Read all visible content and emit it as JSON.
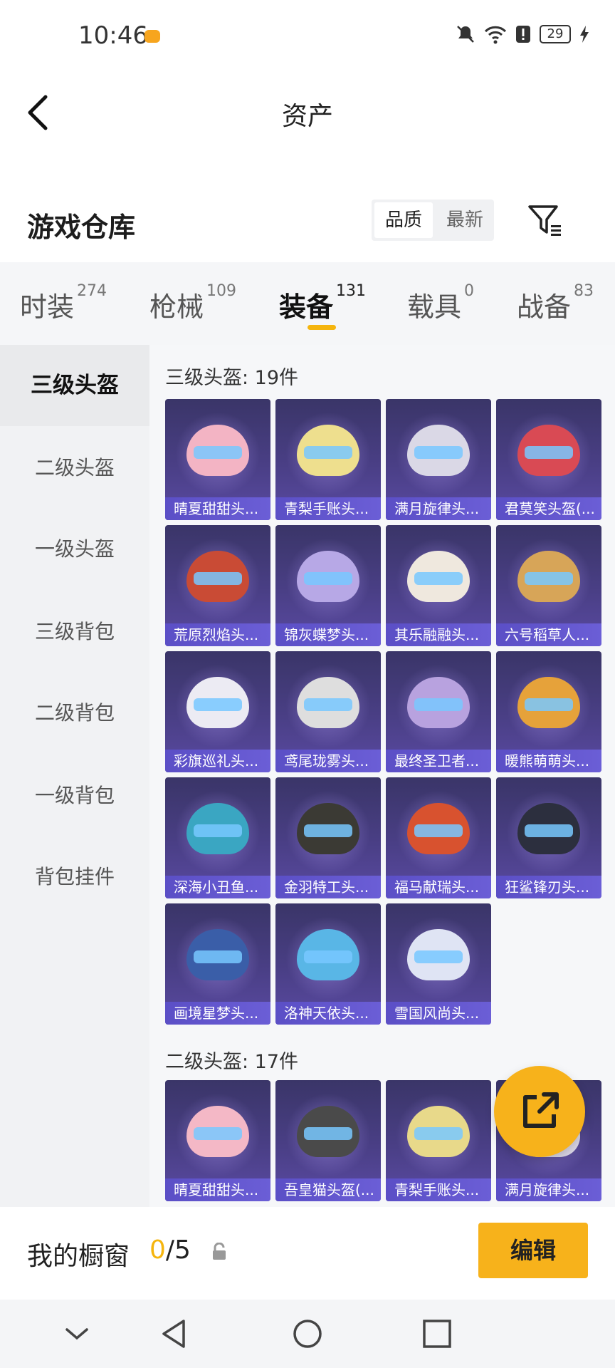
{
  "status_bar": {
    "time": "10:46",
    "battery": "29"
  },
  "header": {
    "title": "资产"
  },
  "warehouse": {
    "title": "游戏仓库",
    "sort_options": [
      "品质",
      "最新"
    ]
  },
  "tabs": [
    {
      "label": "时装",
      "count": "274"
    },
    {
      "label": "枪械",
      "count": "109"
    },
    {
      "label": "装备",
      "count": "131"
    },
    {
      "label": "载具",
      "count": "0"
    },
    {
      "label": "战备",
      "count": "83"
    }
  ],
  "sidebar": {
    "items": [
      "三级头盔",
      "二级头盔",
      "一级头盔",
      "三级背包",
      "二级背包",
      "一级背包",
      "背包挂件"
    ]
  },
  "sections": [
    {
      "title": "三级头盔: 19件",
      "items": [
        "晴夏甜甜头...",
        "青梨手账头...",
        "满月旋律头...",
        "君莫笑头盔(...",
        "荒原烈焰头...",
        "锦灰蝶梦头...",
        "其乐融融头...",
        "六号稻草人...",
        "彩旗巡礼头...",
        "鸢尾珑雾头...",
        "最终圣卫者...",
        "暖熊萌萌头...",
        "深海小丑鱼...",
        "金羽特工头...",
        "福马献瑞头...",
        "狂鲨锋刃头...",
        "画境星梦头...",
        "洛神天依头...",
        "雪国风尚头..."
      ]
    },
    {
      "title": "二级头盔: 17件",
      "items": [
        "晴夏甜甜头...",
        "吾皇猫头盔(...",
        "青梨手账头...",
        "满月旋律头..."
      ]
    }
  ],
  "bottom_bar": {
    "showcase_label": "我的橱窗",
    "showcase_current": "0",
    "showcase_total": "/5",
    "edit_label": "编辑"
  },
  "colors": {
    "accent": "#f7b21b",
    "card_label": "#5b4fc6"
  }
}
